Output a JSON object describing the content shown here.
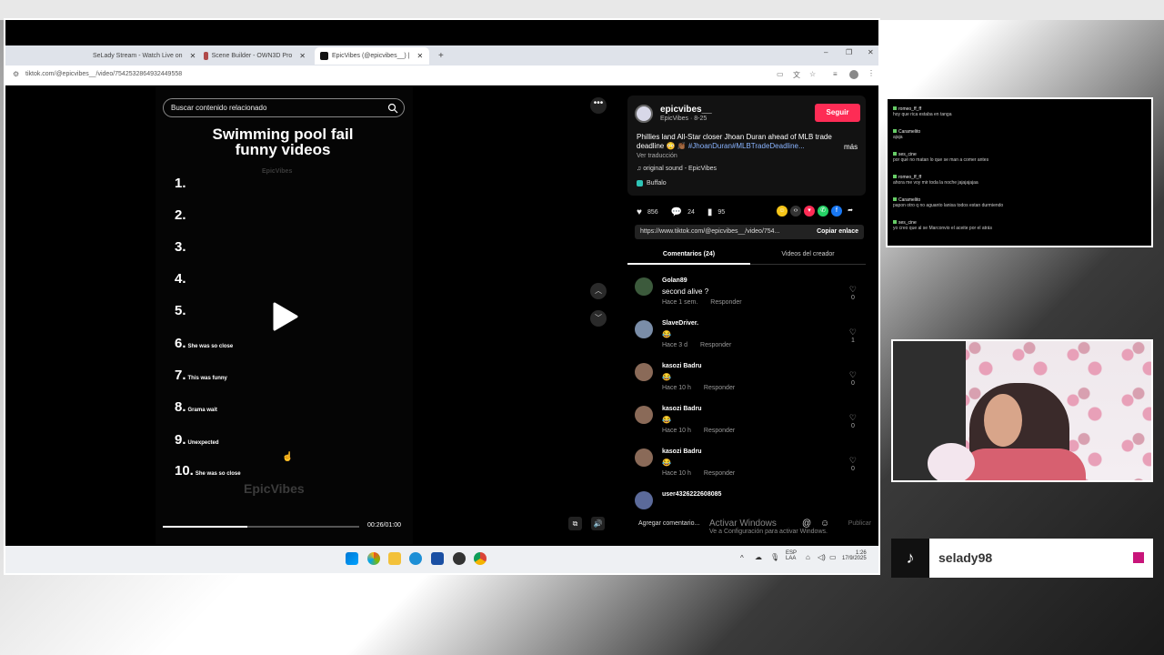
{
  "browser": {
    "tabs": [
      {
        "label": "SeLady Stream - Watch Live on",
        "favicon_color": "#53fc18"
      },
      {
        "label": "Scene Builder - OWN3D Pro",
        "favicon_color": "#b04a4a"
      },
      {
        "label": "EpicVibes (@epicvibes__) |",
        "favicon_color": "#111111"
      }
    ],
    "new_tab": "+",
    "url": "tiktok.com/@epicvibes__/video/7542532864932449558",
    "window_controls": [
      "–",
      "❐",
      "✕"
    ]
  },
  "video": {
    "search_placeholder": "Buscar contenido relacionado",
    "title_line1": "Swimming pool fail",
    "title_line2": "funny videos",
    "watermark_small": "EpicVibes",
    "watermark_large": "EpicVibes",
    "ranks": [
      {
        "num": "1.",
        "label": ""
      },
      {
        "num": "2.",
        "label": ""
      },
      {
        "num": "3.",
        "label": ""
      },
      {
        "num": "4.",
        "label": ""
      },
      {
        "num": "5.",
        "label": ""
      },
      {
        "num": "6.",
        "label": "She was so close"
      },
      {
        "num": "7.",
        "label": "This was funny"
      },
      {
        "num": "8.",
        "label": "Grama wait"
      },
      {
        "num": "9.",
        "label": "Unexpected"
      },
      {
        "num": "10.",
        "label": "She was so close"
      }
    ],
    "progress_fraction": 0.43,
    "time": "00:26/01:00"
  },
  "author": {
    "name": "epicvibes__",
    "sub": "EpicVibes · 8-25",
    "follow_label": "Seguir",
    "caption": "Phillies land All-Star closer Jhoan Duran ahead of MLB trade deadline 😳 👏🏾",
    "caption_tags": "#JhoanDuran#MLBTradeDeadline...",
    "more": "más",
    "translate": "Ver traducción",
    "sound": "original sound - EpicVibes",
    "place": "Buffalo"
  },
  "stats": {
    "likes": "856",
    "comments": "24",
    "saves": "95"
  },
  "link": {
    "url": "https://www.tiktok.com/@epicvibes__/video/754...",
    "copy_label": "Copiar enlace"
  },
  "panel_tabs": {
    "comments": "Comentarios (24)",
    "creator": "Videos del creador"
  },
  "comments": [
    {
      "user": "Golan89",
      "text": "second alive ?",
      "time": "Hace 1 sem.",
      "reply": "Responder",
      "likes": "0"
    },
    {
      "user": "SlaveDriver.",
      "text": "😂",
      "time": "Hace 3 d",
      "reply": "Responder",
      "likes": "1"
    },
    {
      "user": "kasozi Badru",
      "text": "😂",
      "time": "Hace 10 h",
      "reply": "Responder",
      "likes": "0"
    },
    {
      "user": "kasozi Badru",
      "text": "😂",
      "time": "Hace 10 h",
      "reply": "Responder",
      "likes": "0"
    },
    {
      "user": "kasozi Badru",
      "text": "😂",
      "time": "Hace 10 h",
      "reply": "Responder",
      "likes": "0"
    },
    {
      "user": "user4326222608085",
      "text": "",
      "time": "",
      "reply": "",
      "likes": ""
    }
  ],
  "add_comment": {
    "placeholder": "Agregar comentario...",
    "post": "Publicar"
  },
  "windows_activate": {
    "title": "Activar Windows",
    "sub": "Ve a Configuración para activar Windows."
  },
  "taskbar": {
    "lang_line1": "ESP",
    "lang_line2": "LAA",
    "time": "1:26",
    "date": "17/9/2025"
  },
  "chat": [
    {
      "user": "romeo_ff_ff",
      "text": "hoy que rica estaba en tanga"
    },
    {
      "user": "Caramelito",
      "text": "ajaja"
    },
    {
      "user": "ses_cine",
      "text": "por qué no matan lo que se man a comer antes"
    },
    {
      "user": "romeo_ff_ff",
      "text": "ahora me voy mir toda la noche jajajajajaa"
    },
    {
      "user": "Caramelito",
      "text": "papon otro q no aguanto lanisa todos estan durmiendo"
    },
    {
      "user": "ses_cine",
      "text": "yo creo que al se Marconvio el aceite por el atrás"
    }
  ],
  "overlay": {
    "username": "selady98",
    "tiktok_glyph": "♪"
  }
}
